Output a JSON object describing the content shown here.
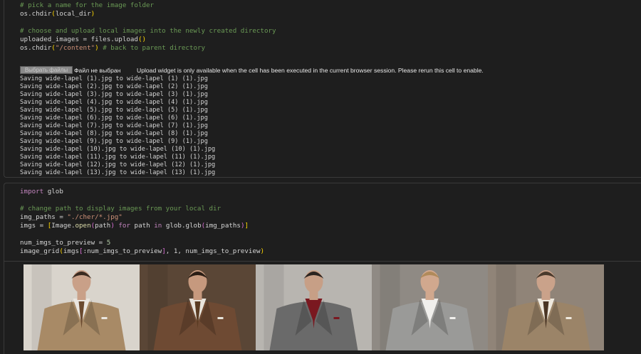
{
  "cell1": {
    "code_lines": [
      {
        "parts": [
          {
            "t": "# pick a name for the image folder",
            "c": "cm"
          }
        ]
      },
      {
        "parts": [
          {
            "t": "os.chdir",
            "c": ""
          },
          {
            "t": "(",
            "c": "par"
          },
          {
            "t": "local_dir",
            "c": ""
          },
          {
            "t": ")",
            "c": "par"
          }
        ]
      },
      {
        "parts": [
          {
            "t": "",
            "c": ""
          }
        ]
      },
      {
        "parts": [
          {
            "t": "# choose and upload local images into the newly created directory",
            "c": "cm"
          }
        ]
      },
      {
        "parts": [
          {
            "t": "uploaded_images = files.upload",
            "c": ""
          },
          {
            "t": "()",
            "c": "par"
          }
        ]
      },
      {
        "parts": [
          {
            "t": "os.chdir",
            "c": ""
          },
          {
            "t": "(",
            "c": "par"
          },
          {
            "t": "\"/content\"",
            "c": "st"
          },
          {
            "t": ")",
            "c": "par"
          },
          {
            "t": " # back to parent directory",
            "c": "cm"
          }
        ]
      }
    ],
    "upload": {
      "button_label": "Выбрать файлы",
      "no_file_label": "Файл не выбран",
      "notice": "Upload widget is only available when the cell has been executed in the current browser session. Please rerun this cell to enable."
    },
    "output_lines": [
      "Saving wide-lapel (1).jpg to wide-lapel (1) (1).jpg",
      "Saving wide-lapel (2).jpg to wide-lapel (2) (1).jpg",
      "Saving wide-lapel (3).jpg to wide-lapel (3) (1).jpg",
      "Saving wide-lapel (4).jpg to wide-lapel (4) (1).jpg",
      "Saving wide-lapel (5).jpg to wide-lapel (5) (1).jpg",
      "Saving wide-lapel (6).jpg to wide-lapel (6) (1).jpg",
      "Saving wide-lapel (7).jpg to wide-lapel (7) (1).jpg",
      "Saving wide-lapel (8).jpg to wide-lapel (8) (1).jpg",
      "Saving wide-lapel (9).jpg to wide-lapel (9) (1).jpg",
      "Saving wide-lapel (10).jpg to wide-lapel (10) (1).jpg",
      "Saving wide-lapel (11).jpg to wide-lapel (11) (1).jpg",
      "Saving wide-lapel (12).jpg to wide-lapel (12) (1).jpg",
      "Saving wide-lapel (13).jpg to wide-lapel (13) (1).jpg"
    ]
  },
  "cell2": {
    "code_lines": [
      {
        "parts": [
          {
            "t": "import",
            "c": "kw"
          },
          {
            "t": " glob",
            "c": ""
          }
        ]
      },
      {
        "parts": [
          {
            "t": "",
            "c": ""
          }
        ]
      },
      {
        "parts": [
          {
            "t": "# change path to display images from your local dir",
            "c": "cm"
          }
        ]
      },
      {
        "parts": [
          {
            "t": "img_paths = ",
            "c": ""
          },
          {
            "t": "\"./cher/*.jpg\"",
            "c": "st"
          }
        ]
      },
      {
        "parts": [
          {
            "t": "imgs = ",
            "c": ""
          },
          {
            "t": "[",
            "c": "par"
          },
          {
            "t": "Image.",
            "c": ""
          },
          {
            "t": "open",
            "c": "fn"
          },
          {
            "t": "(",
            "c": "par2"
          },
          {
            "t": "path",
            "c": ""
          },
          {
            "t": ")",
            "c": "par2"
          },
          {
            "t": " for",
            "c": "kw"
          },
          {
            "t": " path ",
            "c": ""
          },
          {
            "t": "in",
            "c": "kw"
          },
          {
            "t": " glob.glob",
            "c": ""
          },
          {
            "t": "(",
            "c": "par2"
          },
          {
            "t": "img_paths",
            "c": ""
          },
          {
            "t": ")",
            "c": "par2"
          },
          {
            "t": "]",
            "c": "par"
          }
        ]
      },
      {
        "parts": [
          {
            "t": "",
            "c": ""
          }
        ]
      },
      {
        "parts": [
          {
            "t": "num_imgs_to_preview = ",
            "c": ""
          },
          {
            "t": "5",
            "c": "num"
          }
        ]
      },
      {
        "parts": [
          {
            "t": "image_grid",
            "c": ""
          },
          {
            "t": "(",
            "c": "par"
          },
          {
            "t": "imgs",
            "c": ""
          },
          {
            "t": "[",
            "c": "par2"
          },
          {
            "t": ":num_imgs_to_preview",
            "c": ""
          },
          {
            "t": "]",
            "c": "par2"
          },
          {
            "t": ", 1, num_imgs_to_preview",
            "c": ""
          },
          {
            "t": ")",
            "c": "par"
          }
        ]
      }
    ],
    "images": [
      {
        "bg": "#d9d4cc",
        "suit": "#a88a66",
        "shirt": "#eae6e0",
        "tie": "#6b4a2f",
        "skin": "#c9a088",
        "hair": "#3a2a20"
      },
      {
        "bg": "#5a4636",
        "suit": "#6e4a33",
        "shirt": "#e8e4dc",
        "tie": "#5a3b22",
        "skin": "#c6997e",
        "hair": "#2a1d14"
      },
      {
        "bg": "#b8b5b0",
        "suit": "#6a6a6a",
        "shirt": "#7a1820",
        "tie": "#7a1820",
        "skin": "#c79f86",
        "hair": "#2a2420"
      },
      {
        "bg": "#8f8a84",
        "suit": "#9a9a98",
        "shirt": "#f0efec",
        "tie": "#f0efec",
        "skin": "#d1a88e",
        "hair": "#b08a5a"
      },
      {
        "bg": "#908478",
        "suit": "#9b8468",
        "shirt": "#efe9de",
        "tie": "#4a3524",
        "skin": "#caa28a",
        "hair": "#4a3a2c"
      }
    ]
  }
}
